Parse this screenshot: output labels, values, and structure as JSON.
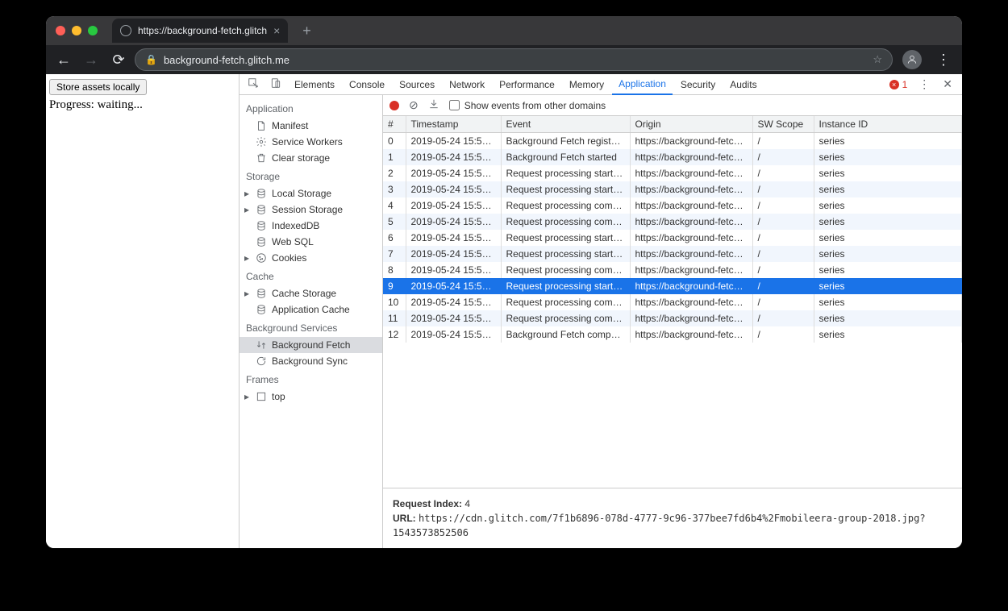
{
  "browser": {
    "tab_title": "https://background-fetch.glitch",
    "url": "background-fetch.glitch.me"
  },
  "page": {
    "button": "Store assets locally",
    "progress": "Progress: waiting..."
  },
  "devtools": {
    "tabs": [
      "Elements",
      "Console",
      "Sources",
      "Network",
      "Performance",
      "Memory",
      "Application",
      "Security",
      "Audits"
    ],
    "active_tab": "Application",
    "error_count": "1",
    "sidebar": {
      "sections": [
        {
          "title": "Application",
          "items": [
            {
              "label": "Manifest",
              "icon": "file"
            },
            {
              "label": "Service Workers",
              "icon": "gear"
            },
            {
              "label": "Clear storage",
              "icon": "trash"
            }
          ]
        },
        {
          "title": "Storage",
          "items": [
            {
              "label": "Local Storage",
              "icon": "db",
              "expandable": true
            },
            {
              "label": "Session Storage",
              "icon": "db",
              "expandable": true
            },
            {
              "label": "IndexedDB",
              "icon": "db"
            },
            {
              "label": "Web SQL",
              "icon": "db"
            },
            {
              "label": "Cookies",
              "icon": "cookie",
              "expandable": true
            }
          ]
        },
        {
          "title": "Cache",
          "items": [
            {
              "label": "Cache Storage",
              "icon": "db",
              "expandable": true
            },
            {
              "label": "Application Cache",
              "icon": "db"
            }
          ]
        },
        {
          "title": "Background Services",
          "items": [
            {
              "label": "Background Fetch",
              "icon": "swap",
              "selected": true
            },
            {
              "label": "Background Sync",
              "icon": "sync"
            }
          ]
        },
        {
          "title": "Frames",
          "items": [
            {
              "label": "top",
              "icon": "frame",
              "expandable": true
            }
          ]
        }
      ]
    },
    "toolbar": {
      "checkbox_label": "Show events from other domains"
    },
    "table": {
      "columns": [
        "#",
        "Timestamp",
        "Event",
        "Origin",
        "SW Scope",
        "Instance ID"
      ],
      "col_widths": [
        "28px",
        "118px",
        "160px",
        "152px",
        "76px",
        "auto"
      ],
      "rows": [
        {
          "n": "0",
          "ts": "2019-05-24 15:5…",
          "ev": "Background Fetch regist…",
          "og": "https://background-fetc…",
          "sw": "/",
          "id": "series"
        },
        {
          "n": "1",
          "ts": "2019-05-24 15:5…",
          "ev": "Background Fetch started",
          "og": "https://background-fetc…",
          "sw": "/",
          "id": "series"
        },
        {
          "n": "2",
          "ts": "2019-05-24 15:5…",
          "ev": "Request processing start…",
          "og": "https://background-fetc…",
          "sw": "/",
          "id": "series"
        },
        {
          "n": "3",
          "ts": "2019-05-24 15:5…",
          "ev": "Request processing start…",
          "og": "https://background-fetc…",
          "sw": "/",
          "id": "series"
        },
        {
          "n": "4",
          "ts": "2019-05-24 15:5…",
          "ev": "Request processing com…",
          "og": "https://background-fetc…",
          "sw": "/",
          "id": "series"
        },
        {
          "n": "5",
          "ts": "2019-05-24 15:5…",
          "ev": "Request processing com…",
          "og": "https://background-fetc…",
          "sw": "/",
          "id": "series"
        },
        {
          "n": "6",
          "ts": "2019-05-24 15:5…",
          "ev": "Request processing start…",
          "og": "https://background-fetc…",
          "sw": "/",
          "id": "series"
        },
        {
          "n": "7",
          "ts": "2019-05-24 15:5…",
          "ev": "Request processing start…",
          "og": "https://background-fetc…",
          "sw": "/",
          "id": "series"
        },
        {
          "n": "8",
          "ts": "2019-05-24 15:5…",
          "ev": "Request processing com…",
          "og": "https://background-fetc…",
          "sw": "/",
          "id": "series"
        },
        {
          "n": "9",
          "ts": "2019-05-24 15:5…",
          "ev": "Request processing start…",
          "og": "https://background-fetc…",
          "sw": "/",
          "id": "series",
          "selected": true
        },
        {
          "n": "10",
          "ts": "2019-05-24 15:5…",
          "ev": "Request processing com…",
          "og": "https://background-fetc…",
          "sw": "/",
          "id": "series"
        },
        {
          "n": "11",
          "ts": "2019-05-24 15:5…",
          "ev": "Request processing com…",
          "og": "https://background-fetc…",
          "sw": "/",
          "id": "series"
        },
        {
          "n": "12",
          "ts": "2019-05-24 15:5…",
          "ev": "Background Fetch comp…",
          "og": "https://background-fetc…",
          "sw": "/",
          "id": "series"
        }
      ]
    },
    "detail": {
      "request_index_label": "Request Index:",
      "request_index_value": "4",
      "url_label": "URL:",
      "url_value": "https://cdn.glitch.com/7f1b6896-078d-4777-9c96-377bee7fd6b4%2Fmobileera-group-2018.jpg?1543573852506"
    }
  }
}
